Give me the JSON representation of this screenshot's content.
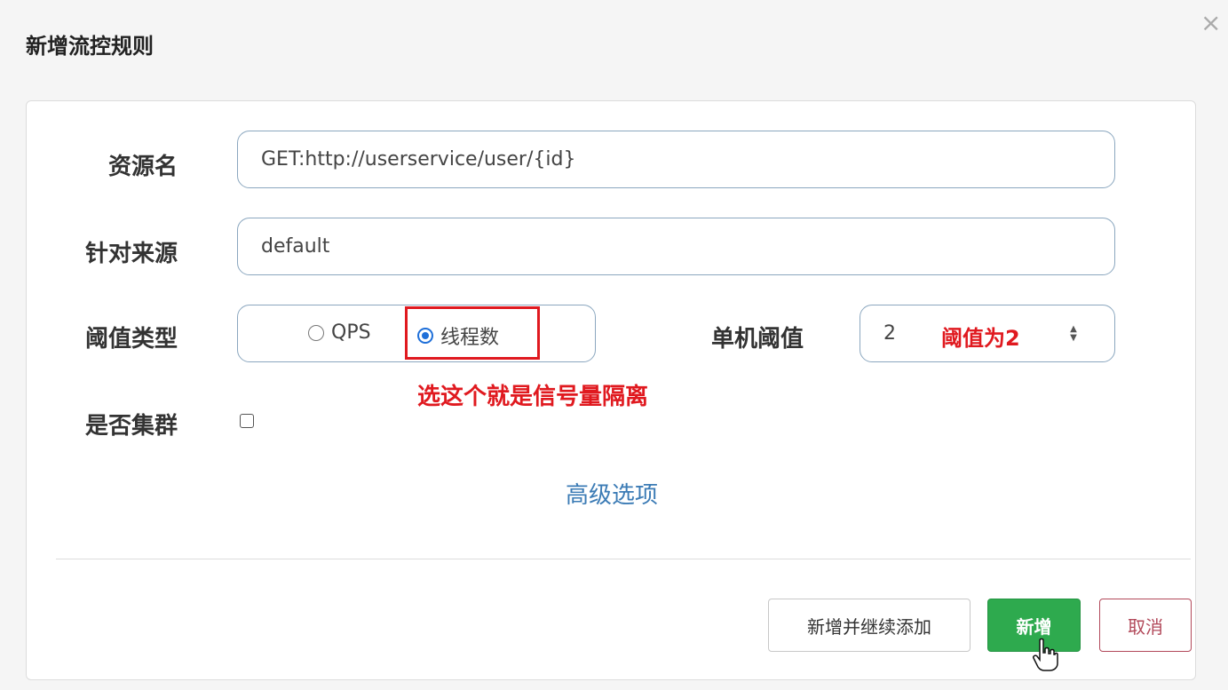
{
  "dialog": {
    "title": "新增流控规则"
  },
  "form": {
    "resource_label": "资源名",
    "resource_value": "GET:http://userservice/user/{id}",
    "source_label": "针对来源",
    "source_value": "default",
    "threshold_type_label": "阈值类型",
    "threshold_options": [
      "QPS",
      "线程数"
    ],
    "threshold_selected": "线程数",
    "single_threshold_label": "单机阈值",
    "single_threshold_value": "2",
    "cluster_label": "是否集群",
    "cluster_checked": false,
    "advanced_link": "高级选项"
  },
  "annotations": {
    "threshold_note": "阈值为2",
    "semaphore_note": "选这个就是信号量隔离"
  },
  "buttons": {
    "add_continue": "新增并继续添加",
    "add": "新增",
    "cancel": "取消"
  },
  "colors": {
    "primary": "#2eaa4e",
    "annotation_red": "#e0191f",
    "link": "#3b7bb5",
    "radio_selected": "#1e6fd9",
    "cancel": "#b2495a"
  },
  "icons": {
    "close": "close-icon",
    "stepper": "stepper-arrows-icon",
    "cursor": "hand-cursor-icon"
  }
}
